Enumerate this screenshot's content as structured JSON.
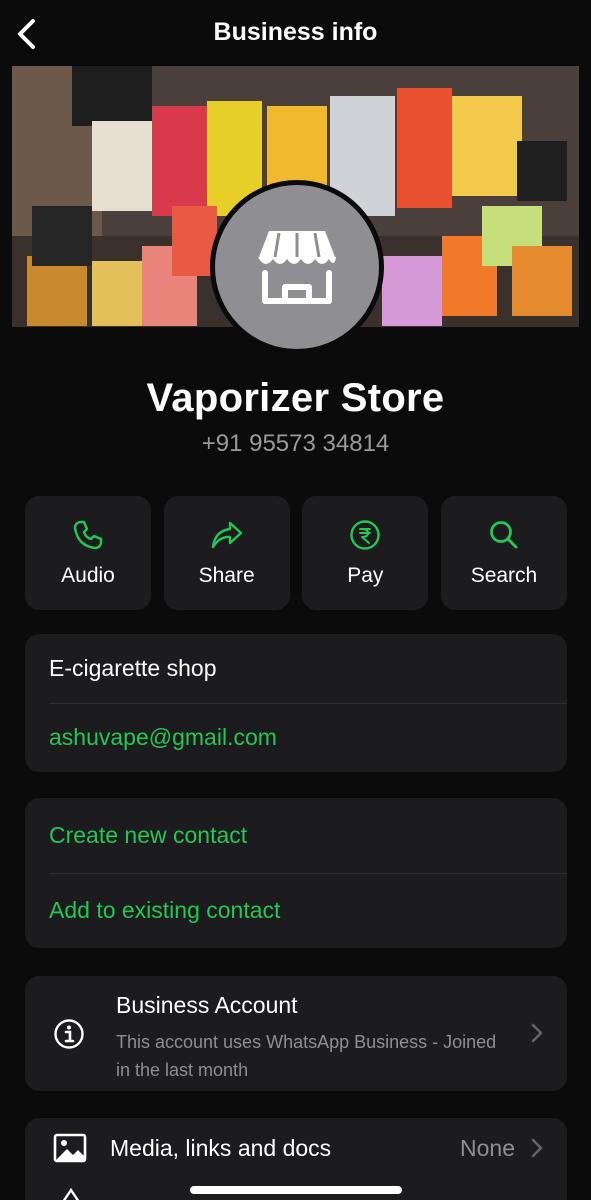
{
  "header": {
    "title": "Business info",
    "back_icon": "chevron-left-icon"
  },
  "profile": {
    "name": "Vaporizer Store",
    "phone": "+91 95573 34814",
    "avatar_icon": "storefront-icon"
  },
  "actions": [
    {
      "label": "Audio",
      "icon": "phone-icon"
    },
    {
      "label": "Share",
      "icon": "share-arrow-icon"
    },
    {
      "label": "Pay",
      "icon": "rupee-icon"
    },
    {
      "label": "Search",
      "icon": "search-icon"
    }
  ],
  "details": {
    "category": "E-cigarette shop",
    "email": "ashuvape@gmail.com"
  },
  "contact_options": {
    "create": "Create new contact",
    "add_existing": "Add to existing contact"
  },
  "business_account": {
    "title": "Business Account",
    "subtitle": "This account uses WhatsApp Business - Joined in the last month",
    "icon": "info-icon"
  },
  "media": {
    "title": "Media, links and docs",
    "value": "None",
    "icon": "photo-icon"
  },
  "colors": {
    "accent": "#25c656",
    "background": "#0b0b0b",
    "card": "#1c1c1e",
    "secondary_text": "#8e8e93"
  }
}
